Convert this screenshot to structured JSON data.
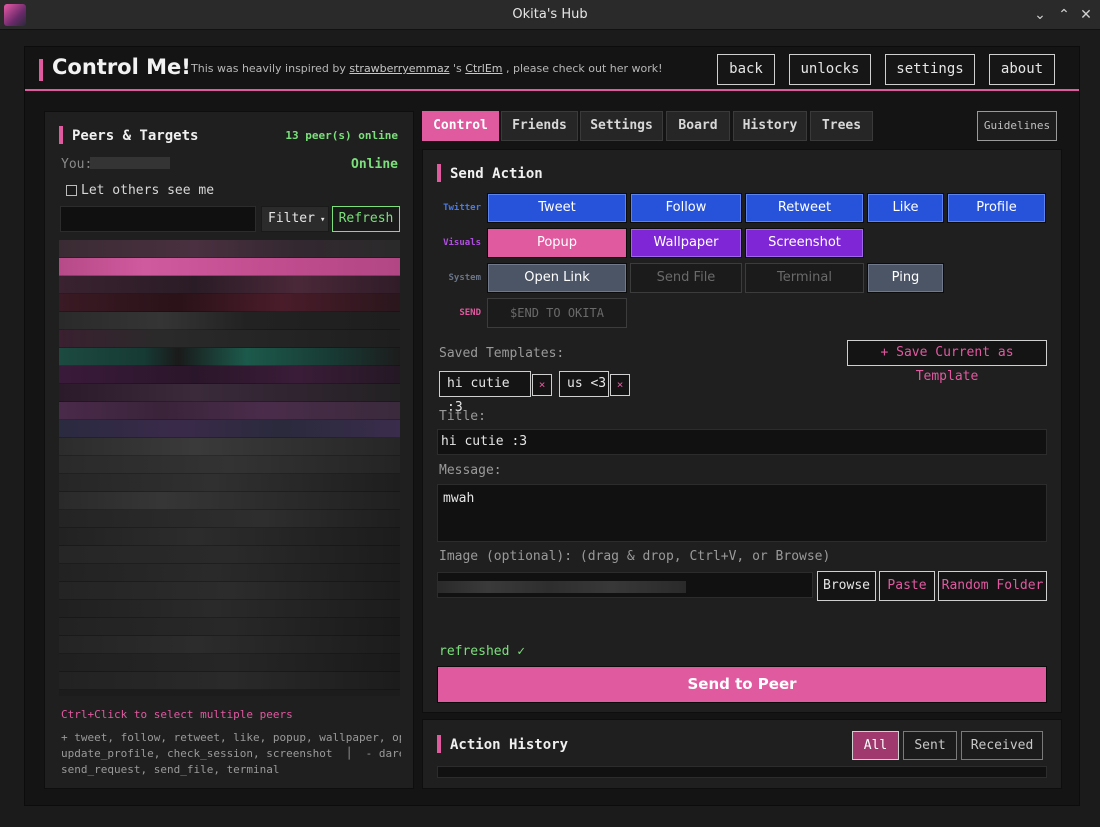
{
  "window": {
    "title": "Okita's Hub"
  },
  "header": {
    "title": "Control Me!",
    "credit_pre": "This was heavily inspired by ",
    "credit_user": "strawberryemmaz",
    "credit_mid": " 's ",
    "credit_link": "CtrlEm",
    "credit_post": " , please check out her work!",
    "nav": [
      "back",
      "unlocks",
      "settings",
      "about"
    ]
  },
  "peers": {
    "title": "Peers & Targets",
    "online_count": "13 peer(s) online",
    "you_label": "You:",
    "you_status": "Online",
    "visibility_label": "Let others see me",
    "filter_label": "Filter",
    "refresh_label": "Refresh",
    "hint": "Ctrl+Click to select multiple peers",
    "actions_line1": "+ tweet, follow, retweet, like, popup, wallpaper, open_url,",
    "actions_line2": "update_profile, check_session, screenshot  │  - dare,",
    "actions_line3": "send_request, send_file, terminal"
  },
  "tabs": [
    "Control",
    "Friends",
    "Settings",
    "Board",
    "History",
    "Trees"
  ],
  "guidelines_label": "Guidelines",
  "send_action": {
    "title": "Send Action",
    "categories": {
      "twitter": "Twitter",
      "visuals": "Visuals",
      "system": "System",
      "send": "SEND"
    },
    "twitter_buttons": [
      "Tweet",
      "Follow",
      "Retweet",
      "Like",
      "Profile"
    ],
    "visual_buttons": [
      "Popup",
      "Wallpaper",
      "Screenshot"
    ],
    "system_buttons": [
      "Open Link",
      "Send File",
      "Terminal",
      "Ping"
    ],
    "send_button": "$END TO OKITA",
    "templates_label": "Saved Templates:",
    "save_template_label": "+ Save Current as Template",
    "templates": [
      "hi cutie :3",
      "us <3"
    ],
    "template_remove_icon": "×",
    "title_label": "Title:",
    "title_value": "hi cutie :3",
    "message_label": "Message:",
    "message_value": "mwah",
    "image_label": "Image (optional):  (drag & drop, Ctrl+V, or Browse)",
    "browse_label": "Browse",
    "paste_label": "Paste",
    "random_folder_label": "Random Folder",
    "status": "refreshed ✓",
    "send_to_peer_label": "Send to Peer"
  },
  "history": {
    "title": "Action History",
    "filters": [
      "All",
      "Sent",
      "Received"
    ]
  },
  "colors": {
    "accent": "#e05aa0",
    "online": "#7be07b",
    "twitter_blue": "#2653d9",
    "visual_purple": "#7f27d6",
    "system_slate": "#4c5566"
  }
}
